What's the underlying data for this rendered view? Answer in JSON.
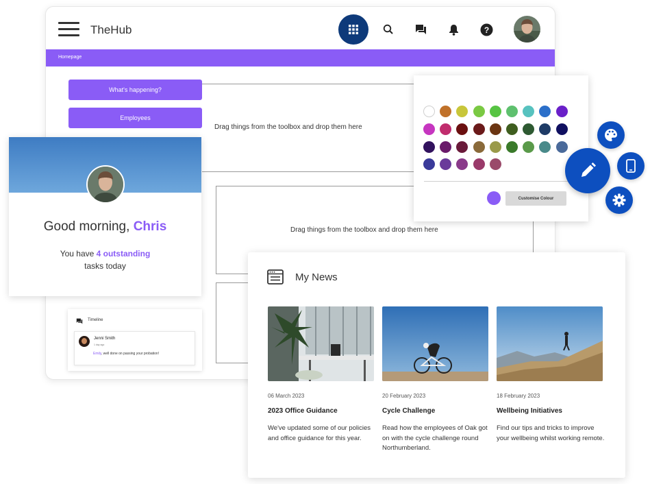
{
  "header": {
    "app_title": "TheHub",
    "icons": [
      "menu-icon",
      "apps-grid-icon",
      "search-icon",
      "chat-icon",
      "bell-icon",
      "help-icon"
    ]
  },
  "breadcrumb": "Homepage",
  "sidebar": {
    "buttons": [
      {
        "label": "What's happening?"
      },
      {
        "label": "Employees"
      }
    ]
  },
  "dropzones": [
    {
      "text": "Drag things from the toolbox and drop them here"
    },
    {
      "text": "Drag things from the toolbox and drop them here"
    }
  ],
  "greeting": {
    "prefix": "Good morning,",
    "name": "Chris",
    "tasks_prefix": "You have",
    "tasks_count": "4 outstanding",
    "tasks_suffix": "tasks today"
  },
  "timeline": {
    "title": "Timeline",
    "post": {
      "author": "Jenni Smith",
      "time": "1 day ago",
      "mention": "Emily",
      "message": ", well done on passing your probation!"
    }
  },
  "color_panel": {
    "swatches": [
      "#ffffff",
      "#c0712a",
      "#c8c63a",
      "#7ac943",
      "#57c443",
      "#5ec06e",
      "#57c2bf",
      "#2b6fc9",
      "#6a20c9",
      "#c636c0",
      "#c02c6d",
      "#6b1010",
      "#6b1a1a",
      "#6b3512",
      "#3f5e1f",
      "#2e5a32",
      "#1e3b66",
      "#101060",
      "#32125e",
      "#6a1a6a",
      "#6a1a3a",
      "#8a6a3a",
      "#9a9a4a",
      "#3a7a2a",
      "#5a9a4a",
      "#4a8a8a",
      "#4a6a9a",
      "#3a3a9a",
      "#6a3a9a",
      "#8a3a8a",
      "#9a3a6a",
      "#9a4a6a"
    ],
    "current_color": "#8a5cf6",
    "customise_label": "Customise Colour"
  },
  "fab": {
    "main_icon": "pencil-icon",
    "options": [
      "palette-icon",
      "mobile-icon",
      "settings-icon"
    ]
  },
  "news": {
    "title": "My News",
    "items": [
      {
        "date": "06 March 2023",
        "headline": "2023 Office Guidance",
        "excerpt": "We've updated some of our policies and office guidance for this year."
      },
      {
        "date": "20 February 2023",
        "headline": "Cycle Challenge",
        "excerpt": "Read how the employees of Oak got on with the cycle challenge round Northumberland."
      },
      {
        "date": "18 February 2023",
        "headline": "Wellbeing Initiatives",
        "excerpt": "Find our tips and tricks to improve your wellbeing whilst working remote."
      }
    ]
  },
  "colors": {
    "accent": "#8a5cf6",
    "primary": "#0d4fbf",
    "nav_dark": "#0e3a7a"
  }
}
